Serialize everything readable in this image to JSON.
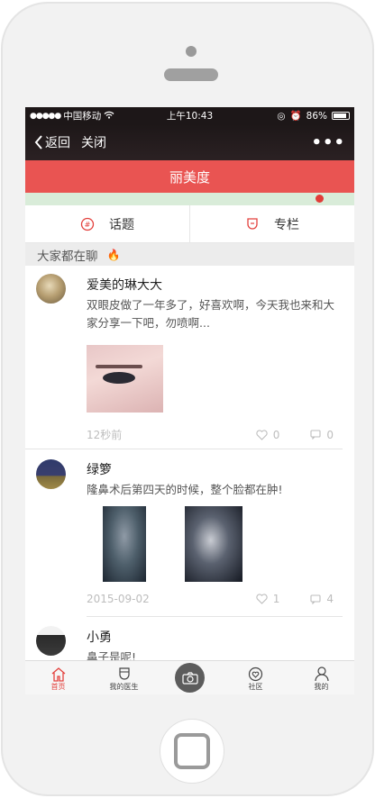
{
  "status_bar": {
    "signal": "●●●●●",
    "carrier": "中国移动",
    "time": "上午10:43",
    "battery": "86%"
  },
  "nav": {
    "back_label": "返回",
    "close_label": "关闭",
    "more_label": "•••"
  },
  "banner_title": "丽美度",
  "tabs": [
    {
      "label": "话题",
      "icon": "topic-icon"
    },
    {
      "label": "专栏",
      "icon": "column-icon"
    }
  ],
  "section_title": "大家都在聊",
  "posts": [
    {
      "name": "爱美的琳大大",
      "text": "双眼皮做了一年多了，好喜欢啊，今天我也来和大家分享一下吧，勿喷啊...",
      "time": "12秒前",
      "likes": "0",
      "comments": "0"
    },
    {
      "name": "绿箩",
      "text": "隆鼻术后第四天的时候，整个脸都在肿!",
      "time": "2015-09-02",
      "likes": "1",
      "comments": "4"
    },
    {
      "name": "小勇",
      "text": "鼻子是呢!"
    }
  ],
  "tabbar": [
    {
      "label": "首页",
      "icon": "home-icon",
      "active": true
    },
    {
      "label": "我的医生",
      "icon": "doctor-icon"
    },
    {
      "label": "",
      "icon": "camera-icon"
    },
    {
      "label": "社区",
      "icon": "community-icon"
    },
    {
      "label": "我的",
      "icon": "profile-icon"
    }
  ],
  "colors": {
    "accent": "#e95452",
    "nav_bg": "#1d1718"
  }
}
